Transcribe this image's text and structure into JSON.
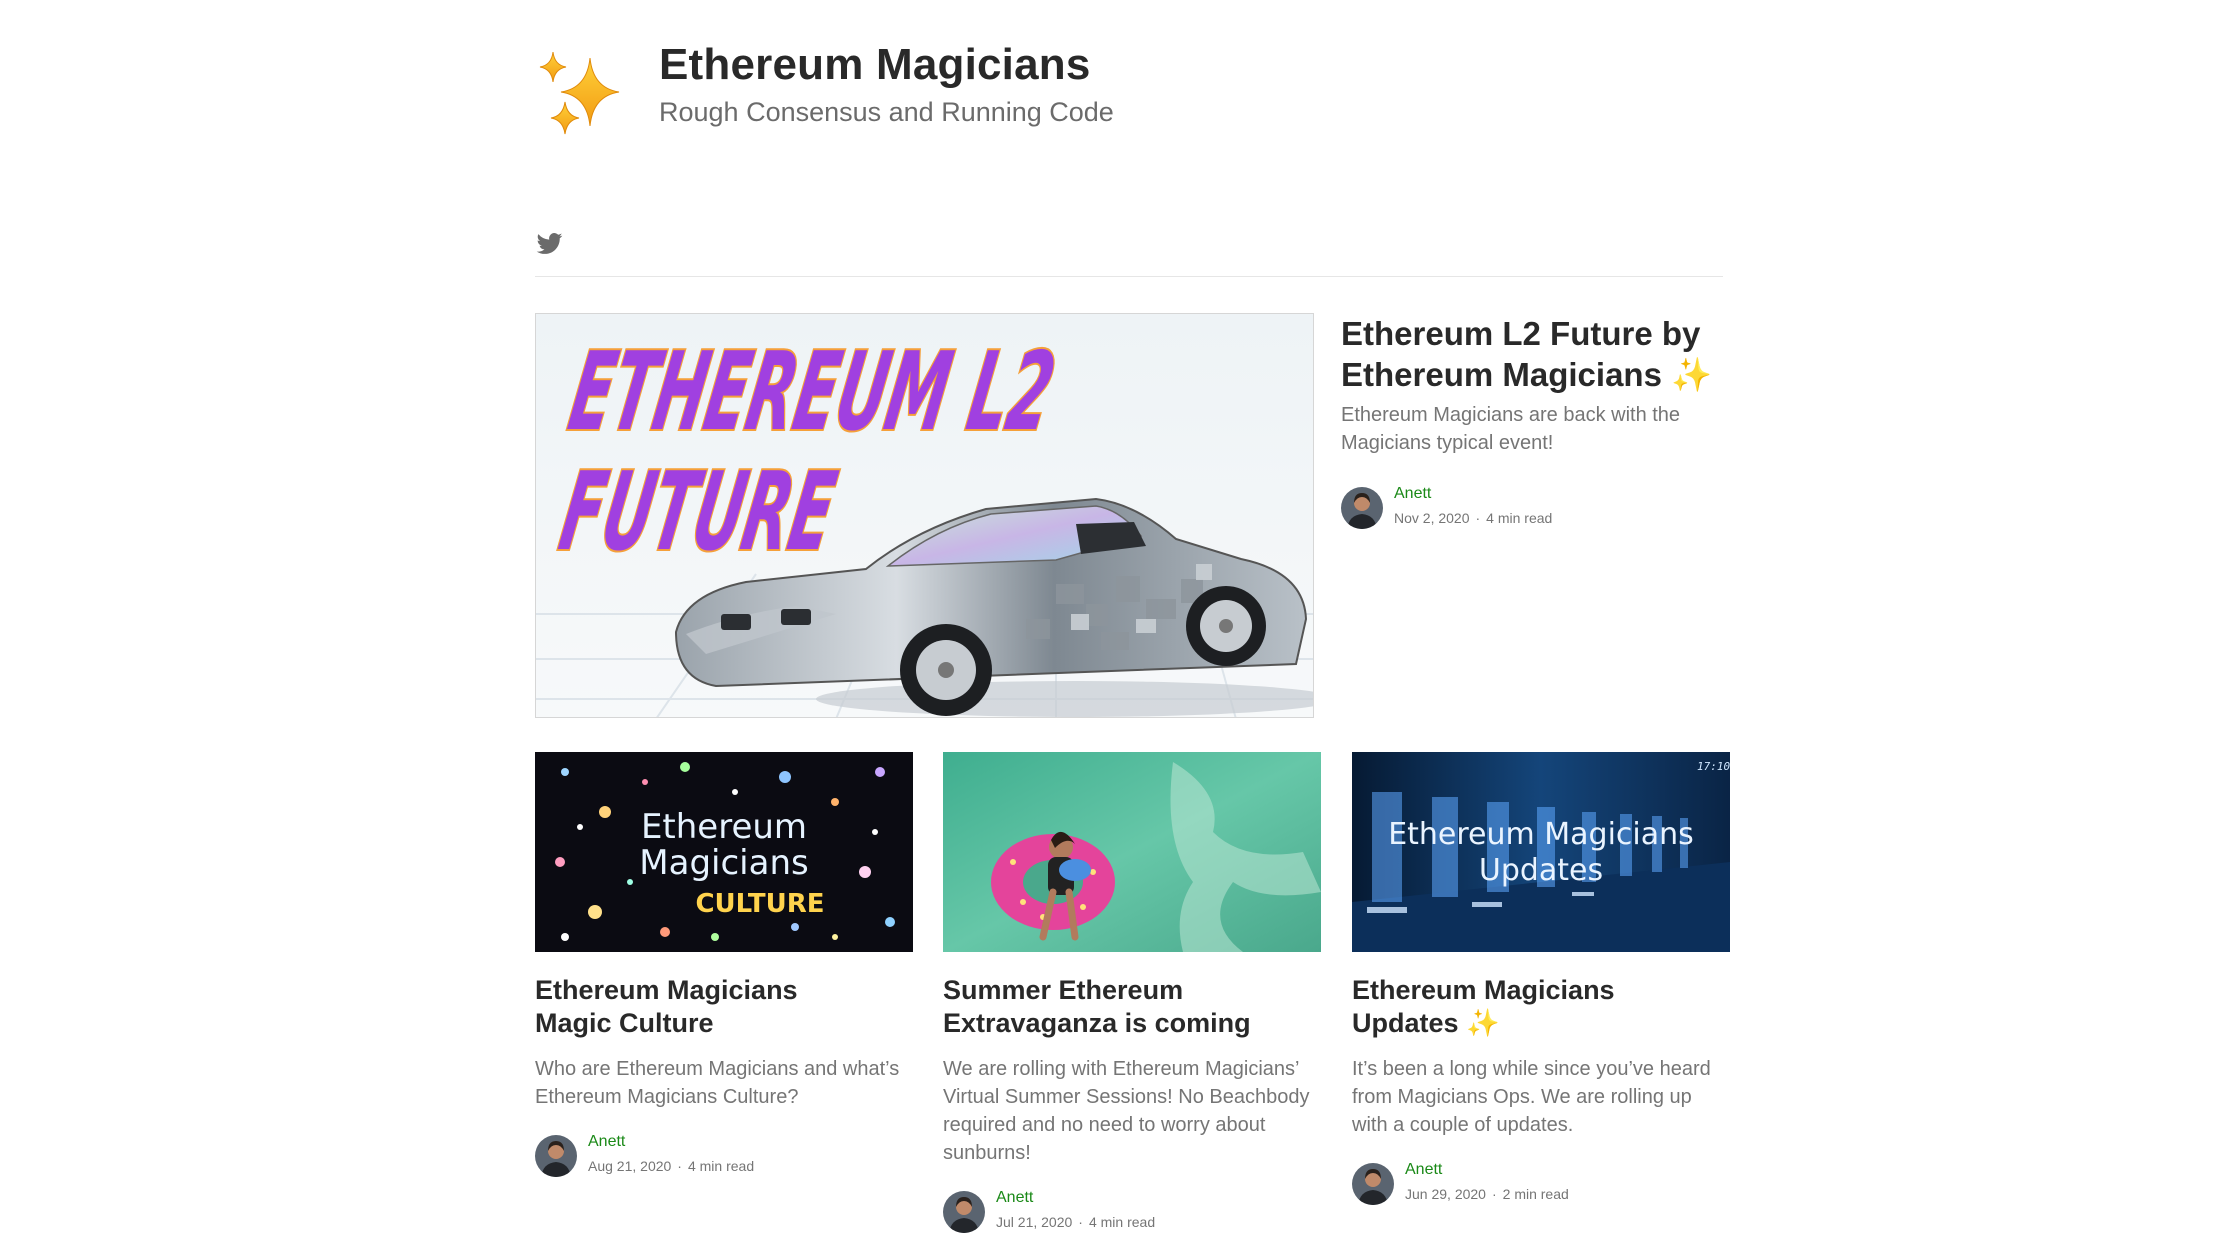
{
  "publication": {
    "title": "Ethereum Magicians",
    "tagline": "Rough Consensus and Running Code"
  },
  "social": {
    "icon": "twitter-icon"
  },
  "featured": {
    "image_text_line1": "ETHEREUM L2",
    "image_text_line2": "FUTURE",
    "title": "Ethereum L2 Future by Ethereum Magicians",
    "title_emoji": "✨",
    "subtitle": "Ethereum Magicians are back with the Magicians typical event!",
    "author": "Anett",
    "date": "Nov 2, 2020",
    "read_time": "4 min read"
  },
  "posts": [
    {
      "image_text_line1": "Ethereum",
      "image_text_line2": "Magicians",
      "image_text_line3": "CULTURE",
      "title_line1": "Ethereum Magicians",
      "title_line2": "Magic Culture",
      "title_emoji": "",
      "subtitle": "Who are Ethereum Magicians and what’s Ethereum Magicians Culture?",
      "author": "Anett",
      "date": "Aug 21, 2020",
      "read_time": "4 min read"
    },
    {
      "title_line1": "Summer Ethereum",
      "title_line2": "Extravaganza is coming",
      "title_emoji": "",
      "subtitle": "We are rolling with Ethereum Magicians’ Virtual Summer Sessions! No Beachbody required and no need to worry about sunburns!",
      "author": "Anett",
      "date": "Jul 21, 2020",
      "read_time": "4 min read"
    },
    {
      "image_text_line1": "Ethereum Magicians",
      "image_text_line2": "Updates",
      "image_clock": "17:10",
      "title_line1": "Ethereum Magicians",
      "title_line2": "Updates",
      "title_emoji": "✨",
      "subtitle": "It’s been a long while since you’ve heard from Magicians Ops. We are rolling up with a couple of updates.",
      "author": "Anett",
      "date": "Jun 29, 2020",
      "read_time": "2 min read"
    }
  ],
  "meta_separator": "·",
  "colors": {
    "author": "#1a8917",
    "hero_text": "#a040e0",
    "hero_outline": "#f5a03a"
  }
}
